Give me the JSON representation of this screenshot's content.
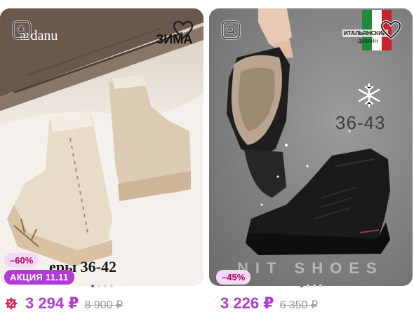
{
  "cards": [
    {
      "brand": "ardanu",
      "season": "ЗИМА",
      "sizes_text": "еры 36-42",
      "discount": "–60%",
      "promo": "АКЦИЯ 11.11",
      "price": "3 294 ₽",
      "old_price": "8 900 ₽",
      "dots": 4,
      "active_dot": 0
    },
    {
      "design_label": "ИТАЛЬЯНСКИЙ",
      "design_sub": "ДИЗАЙН",
      "sizes": "36-43",
      "watermark": "NIT SHOES",
      "discount": "–45%",
      "price": "3 226 ₽",
      "old_price": "6 350 ₽",
      "dots": 4,
      "active_dot": 0
    }
  ],
  "colors": {
    "accent": "#b03bd8",
    "discount_text": "#c4005e",
    "discount_bg": "#f3d9f5"
  },
  "icons": [
    "similar-search-icon",
    "heart-icon",
    "promo-flower-icon",
    "snowflake-icon"
  ]
}
